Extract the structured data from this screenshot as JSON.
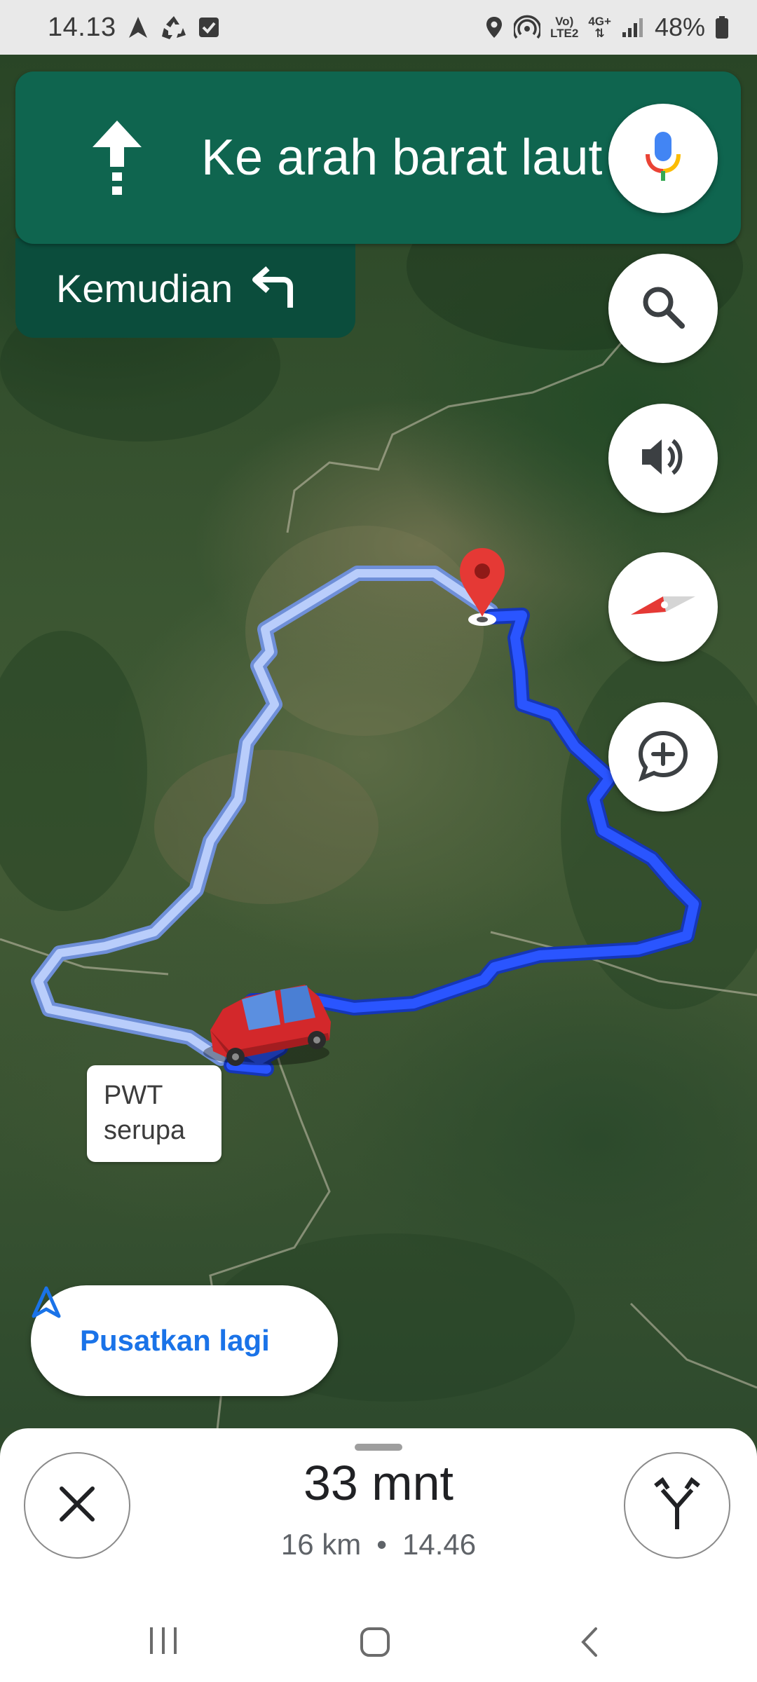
{
  "status_bar": {
    "time": "14.13",
    "network_label_top": "Vo)",
    "network_label_bottom": "LTE2",
    "data_label_top": "4G+",
    "battery": "48%"
  },
  "navigation": {
    "instruction": "Ke arah barat laut",
    "then_label": "Kemudian",
    "next_turn": "turn-left"
  },
  "map": {
    "route_label_line1": "PWT",
    "route_label_line2": "serupa",
    "recenter_label": "Pusatkan lagi"
  },
  "controls": {
    "voice": "microphone-icon",
    "search": "search-icon",
    "sound": "speaker-icon",
    "compass": "compass-icon",
    "report": "add-report-icon"
  },
  "trip": {
    "duration": "33 mnt",
    "distance": "16 km",
    "separator": "•",
    "arrival": "14.46"
  },
  "colors": {
    "nav_green": "#0f654f",
    "then_green": "#0b4d3c",
    "route_blue": "#1f4dff",
    "alt_route": "#a9c4ff",
    "accent_blue": "#1a73e8",
    "pin_red": "#e53935"
  }
}
